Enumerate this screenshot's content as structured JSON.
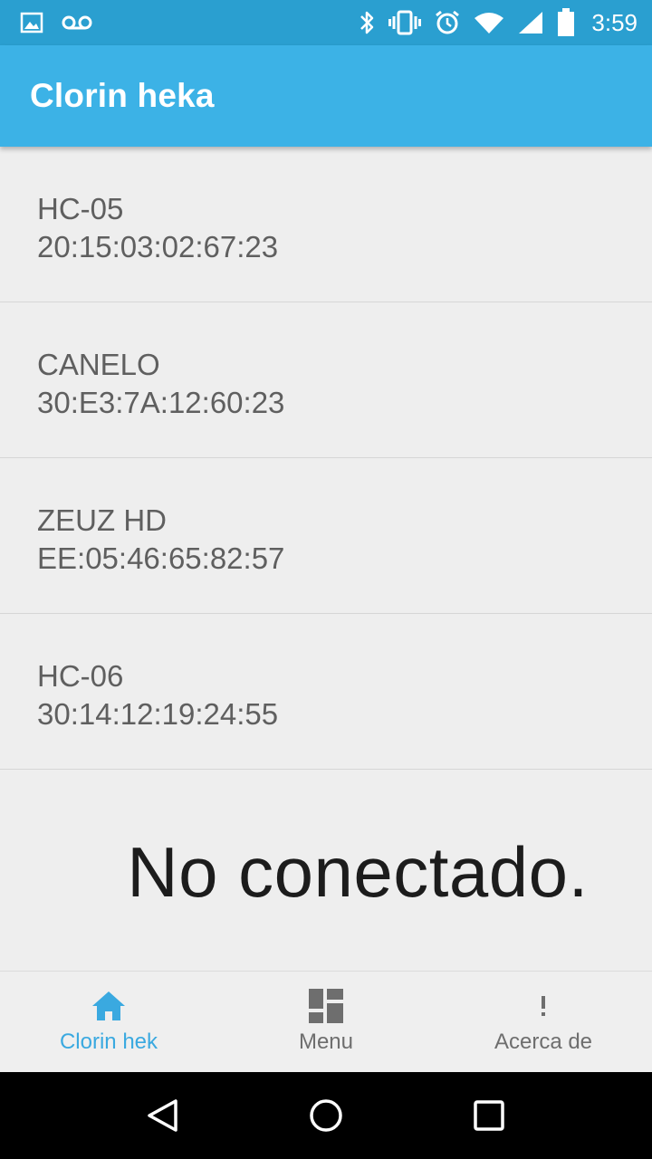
{
  "status_bar": {
    "time": "3:59",
    "icons": [
      "image-icon",
      "voicemail-icon",
      "bluetooth-icon",
      "vibrate-icon",
      "alarm-icon",
      "wifi-icon",
      "signal-icon",
      "battery-icon"
    ]
  },
  "app_bar": {
    "title": "Clorin heka"
  },
  "devices": [
    {
      "name": "HC-05",
      "address": "20:15:03:02:67:23"
    },
    {
      "name": "CANELO",
      "address": "30:E3:7A:12:60:23"
    },
    {
      "name": "ZEUZ HD",
      "address": "EE:05:46:65:82:57"
    },
    {
      "name": "HC-06",
      "address": "30:14:12:19:24:55"
    }
  ],
  "connection_status": "No conectado.",
  "bottom_nav": {
    "items": [
      {
        "label": "Clorin hek",
        "icon": "home-icon",
        "active": true
      },
      {
        "label": "Menu",
        "icon": "dashboard-icon",
        "active": false
      },
      {
        "label": "Acerca de",
        "icon": "exclamation-icon",
        "active": false
      }
    ]
  },
  "colors": {
    "status_bar": "#2a9fd0",
    "app_bar": "#3cb2e6",
    "accent": "#3aa9e0",
    "background": "#eeeeee"
  }
}
